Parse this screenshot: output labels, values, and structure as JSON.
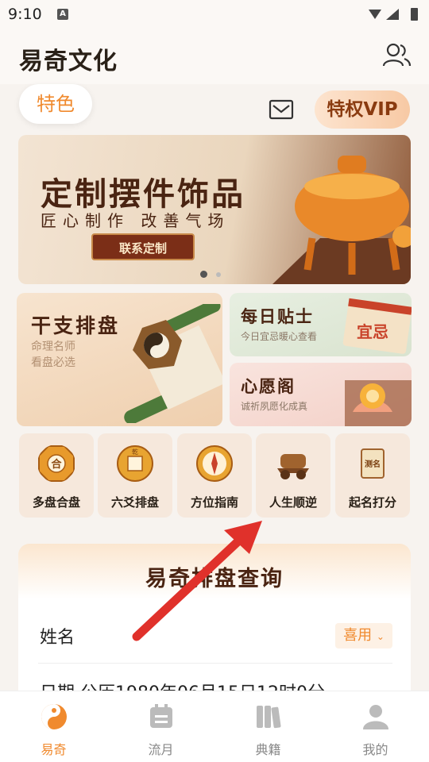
{
  "status": {
    "time": "9:10",
    "notif": "A"
  },
  "header": {
    "title": "易奇文化"
  },
  "special": "特色",
  "vip": "特权VIP",
  "banner": {
    "title": "定制摆件饰品",
    "subtitle": "匠心制作 改善气场",
    "button": "联系定制"
  },
  "cards": [
    {
      "title": "干支排盘",
      "subtitle": "命理名师\n看盘必选"
    },
    {
      "title": "每日贴士",
      "subtitle": "今日宜忌暖心查看",
      "badge": "宜忌"
    },
    {
      "title": "心愿阁",
      "subtitle": "诚祈夙愿化成真"
    }
  ],
  "tools": [
    {
      "label": "多盘合盘",
      "icon": "bagua-icon",
      "glyph": "合"
    },
    {
      "label": "六爻排盘",
      "icon": "coin-icon",
      "glyph": "乾"
    },
    {
      "label": "方位指南",
      "icon": "compass-icon",
      "glyph": "✦"
    },
    {
      "label": "人生顺逆",
      "icon": "cart-icon",
      "glyph": "⛟"
    },
    {
      "label": "起名打分",
      "icon": "scroll-icon",
      "glyph": "测名"
    }
  ],
  "query": {
    "title": "易奇排盘查询",
    "name_label": "姓名",
    "name_tag": "喜用",
    "date_row": "日期  公历1980年06月15日12时0分"
  },
  "tabs": [
    {
      "label": "易奇",
      "icon": "yiqi-icon"
    },
    {
      "label": "流月",
      "icon": "calendar-icon"
    },
    {
      "label": "典籍",
      "icon": "books-icon"
    },
    {
      "label": "我的",
      "icon": "user-icon"
    }
  ],
  "colors": {
    "accent": "#f08a2e",
    "arrow": "#e0312b",
    "brown": "#4a2412"
  }
}
